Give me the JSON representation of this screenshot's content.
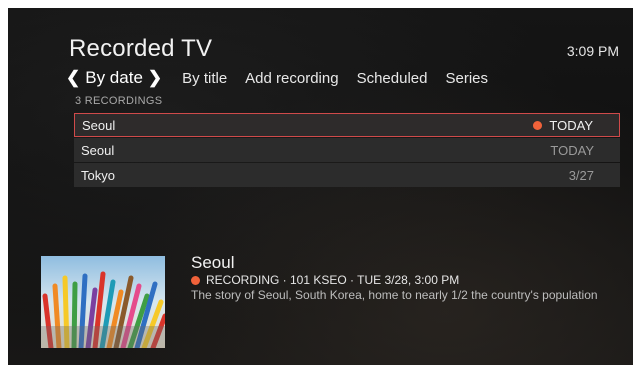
{
  "header": {
    "title": "Recorded TV",
    "clock": "3:09 PM"
  },
  "tabs": [
    {
      "label": "By date",
      "active": true
    },
    {
      "label": "By title"
    },
    {
      "label": "Add recording"
    },
    {
      "label": "Scheduled"
    },
    {
      "label": "Series"
    }
  ],
  "recordings_count": "3 RECORDINGS",
  "recordings": [
    {
      "title": "Seoul",
      "date": "TODAY",
      "recording": true,
      "selected": true
    },
    {
      "title": "Seoul",
      "date": "TODAY"
    },
    {
      "title": "Tokyo",
      "date": "3/27"
    }
  ],
  "detail": {
    "title": "Seoul",
    "meta": "RECORDING · 101 KSEO · TUE 3/28, 3:00 PM",
    "description": "The story of Seoul, South Korea, home to nearly 1/2 the country's population"
  },
  "colors": {
    "accent": "#d04a4a",
    "recording_dot": "#f0623a"
  },
  "icons": [
    "chevron-left-icon",
    "chevron-right-icon",
    "recording-dot-icon"
  ]
}
